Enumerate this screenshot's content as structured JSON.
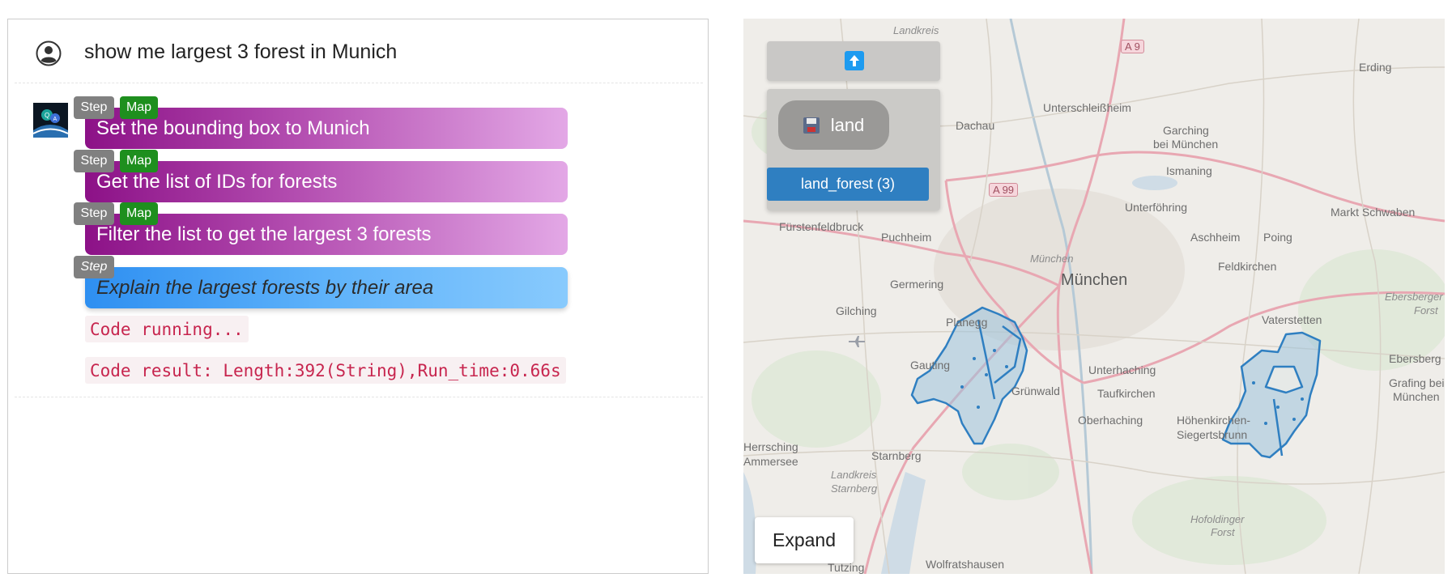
{
  "chat": {
    "user_query": "show me largest 3 forest in Munich",
    "tags": {
      "step": "Step",
      "map": "Map"
    },
    "steps": [
      {
        "text": "Set the bounding box to Munich",
        "has_map": true
      },
      {
        "text": "Get the list of IDs for forests",
        "has_map": true
      },
      {
        "text": "Filter the list to get the largest 3 forests",
        "has_map": true
      },
      {
        "text": "Explain the largest forests by their area",
        "has_map": false
      }
    ],
    "code_status": "Code running...",
    "code_result": "Code result: Length:392(String),Run_time:0.66s"
  },
  "map": {
    "layer_group_label": "land",
    "layer_button_label": "land_forest (3)",
    "expand_label": "Expand",
    "city_label": "München",
    "city_label_small": "München",
    "places": [
      "Landkreis",
      "Dachau",
      "Unterschleißheim",
      "Garching",
      "bei München",
      "Ismaning",
      "Unterföhring",
      "Erding",
      "Markt Schwaben",
      "Fürstenfeldbruck",
      "Puchheim",
      "Aschheim",
      "Poing",
      "Feldkirchen",
      "Germering",
      "Gilching",
      "Planegg",
      "Vaterstetten",
      "Gauting",
      "Grünwald",
      "Unterhaching",
      "Taufkirchen",
      "Oberhaching",
      "Höhenkirchen-",
      "Siegertsbrunn",
      "Ebersberg",
      "Grafing bei",
      "München",
      "Starnberg",
      "Herrsching",
      "Ammersee",
      "Landkreis",
      "Starnberg",
      "Tutzing",
      "Wolfratshausen",
      "Hofoldinger",
      "Forst",
      "Ebersberger",
      "Forst"
    ],
    "road_shields": [
      "A 9",
      "A 99"
    ],
    "colors": {
      "forest_fill": "#9cc3dd",
      "forest_stroke": "#2f7fc1",
      "accent": "#2f7fc1"
    }
  }
}
